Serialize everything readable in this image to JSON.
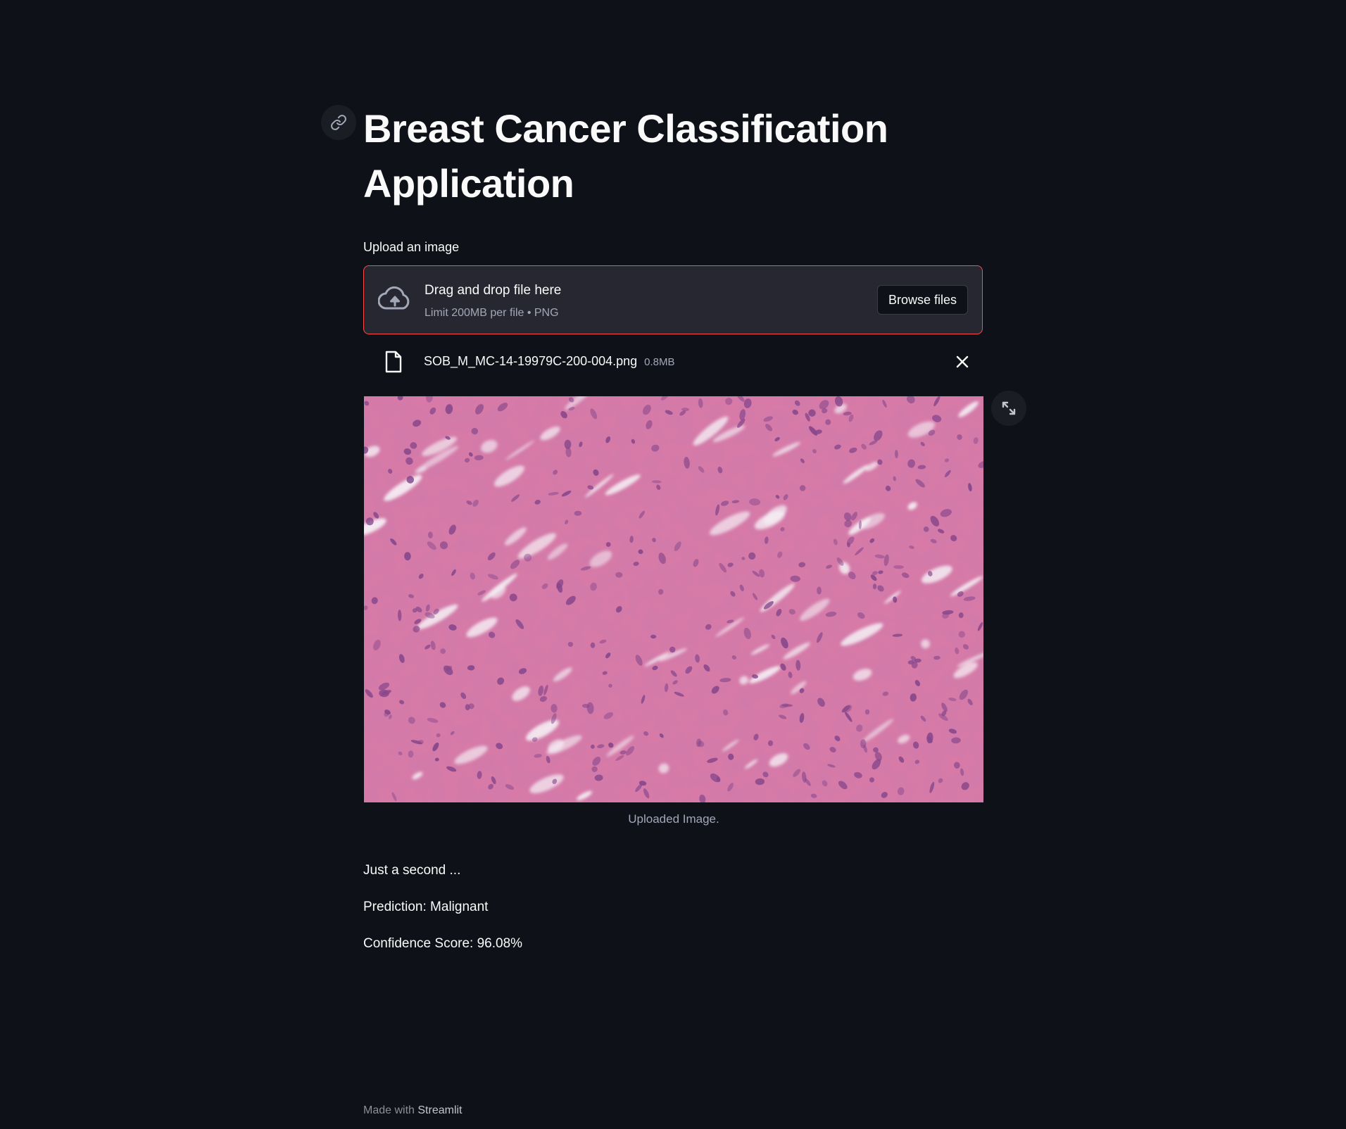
{
  "header": {
    "title": "Breast Cancer Classification Application"
  },
  "uploader": {
    "label": "Upload an image",
    "dropzone_title": "Drag and drop file here",
    "dropzone_subtitle": "Limit 200MB per file • PNG",
    "browse_label": "Browse files",
    "accent_color": "#ff4b4b",
    "icon": "cloud-upload-icon"
  },
  "uploaded_file": {
    "name": "SOB_M_MC-14-19979C-200-004.png",
    "size": "0.8MB",
    "icon": "file-icon"
  },
  "image": {
    "caption": "Uploaded Image."
  },
  "results": {
    "status": "Just a second ...",
    "prediction": "Prediction: Malignant",
    "confidence": "Confidence Score: 96.08%"
  },
  "footer": {
    "prefix": "Made with",
    "brand": "Streamlit"
  },
  "theme": {
    "background": "#0e1117",
    "surface": "#262730",
    "text": "#fafafa",
    "muted": "#a3a8b8"
  }
}
